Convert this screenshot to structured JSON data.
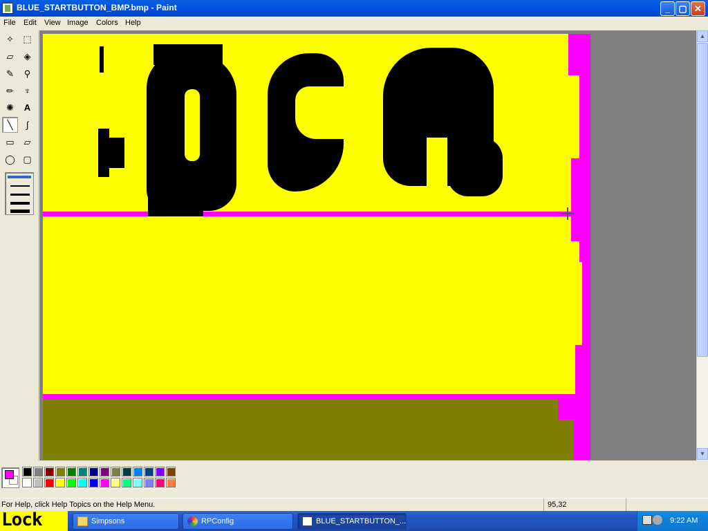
{
  "window": {
    "title": "BLUE_STARTBUTTON_BMP.bmp - Paint",
    "buttons": {
      "minimize": "_",
      "maximize": "▢",
      "close": "✕"
    }
  },
  "menu": [
    "File",
    "Edit",
    "View",
    "Image",
    "Colors",
    "Help"
  ],
  "tools": [
    {
      "name": "free-form-select",
      "glyph": "✧"
    },
    {
      "name": "select",
      "glyph": "⬚"
    },
    {
      "name": "eraser",
      "glyph": "▱"
    },
    {
      "name": "fill",
      "glyph": "◈"
    },
    {
      "name": "pick-color",
      "glyph": "✎"
    },
    {
      "name": "magnifier",
      "glyph": "⚲"
    },
    {
      "name": "pencil",
      "glyph": "✏"
    },
    {
      "name": "brush",
      "glyph": "♆"
    },
    {
      "name": "airbrush",
      "glyph": "✺"
    },
    {
      "name": "text",
      "glyph": "A"
    },
    {
      "name": "line",
      "glyph": "╲"
    },
    {
      "name": "curve",
      "glyph": "∫"
    },
    {
      "name": "rectangle",
      "glyph": "▭"
    },
    {
      "name": "polygon",
      "glyph": "▱"
    },
    {
      "name": "ellipse",
      "glyph": "◯"
    },
    {
      "name": "rounded-rectangle",
      "glyph": "▢"
    }
  ],
  "colors": {
    "foreground": "#ff00ff",
    "background": "#ffffff",
    "canvas": "#ffff00",
    "palette_row1": [
      "#000000",
      "#808080",
      "#800000",
      "#808000",
      "#008000",
      "#008080",
      "#000080",
      "#800080",
      "#808040",
      "#004040",
      "#0080ff",
      "#004080",
      "#8000ff",
      "#804000"
    ],
    "palette_row2": [
      "#ffffff",
      "#c0c0c0",
      "#ff0000",
      "#ffff00",
      "#00ff00",
      "#00ffff",
      "#0000ff",
      "#ff00ff",
      "#ffff80",
      "#00ff80",
      "#80ffff",
      "#8080ff",
      "#ff0080",
      "#ff8040"
    ]
  },
  "status": {
    "help_text": "For Help, click Help Topics on the Help Menu.",
    "coordinates": "95,32"
  },
  "taskbar": {
    "start_text": "Lock",
    "tasks": [
      {
        "label": "Simpsons",
        "icon": "folder-icon",
        "active": false
      },
      {
        "label": "RPConfig",
        "icon": "rpconfig-icon",
        "active": false
      },
      {
        "label": "BLUE_STARTBUTTON_...",
        "icon": "paint-icon",
        "active": true
      }
    ],
    "clock": "9:22 AM"
  }
}
